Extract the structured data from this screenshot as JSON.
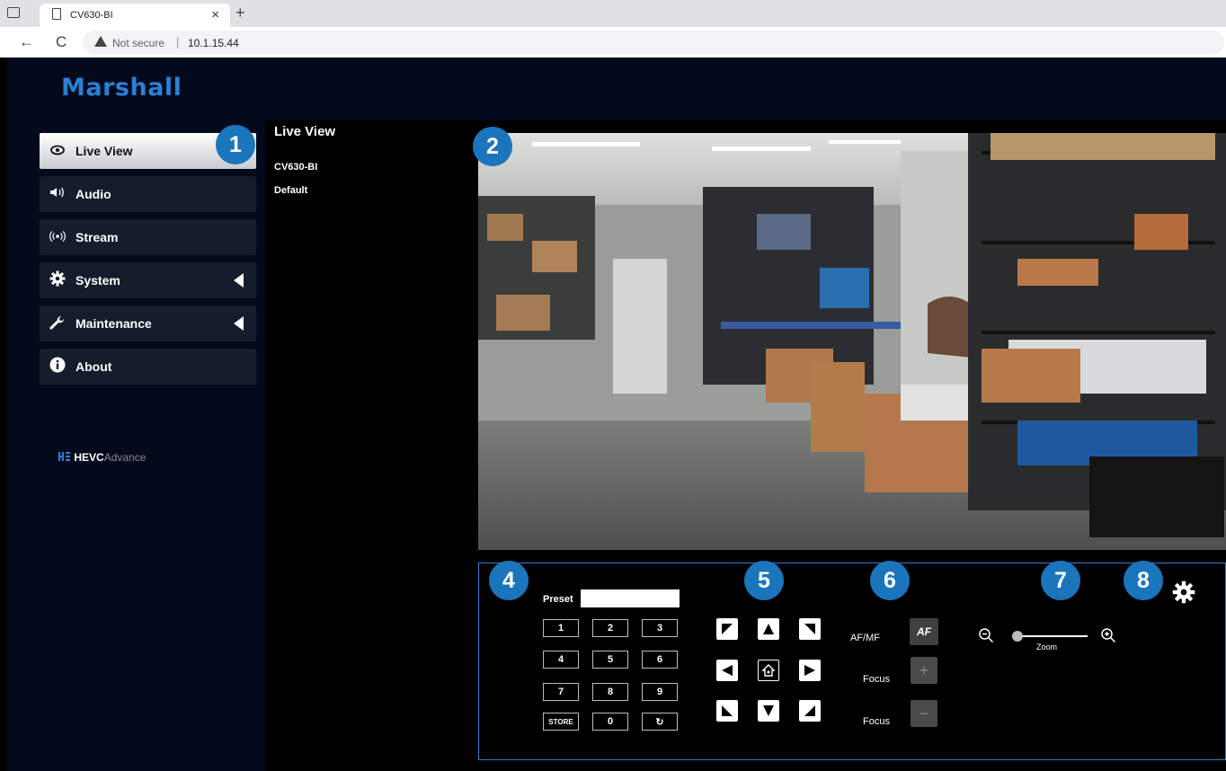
{
  "browser": {
    "tab_title": "CV630-BI",
    "close_glyph": "×",
    "new_tab_glyph": "+",
    "back_glyph": "←",
    "reload_glyph": "C",
    "security_text": "Not secure",
    "url": "10.1.15.44"
  },
  "header": {
    "logo_text": "Marshall"
  },
  "sidebar": {
    "items": [
      {
        "label": "Live View",
        "icon": "eye-icon",
        "active": true
      },
      {
        "label": "Audio",
        "icon": "speaker-icon"
      },
      {
        "label": "Stream",
        "icon": "broadcast-icon"
      },
      {
        "label": "System",
        "icon": "gear-icon",
        "expandable": true
      },
      {
        "label": "Maintenance",
        "icon": "wrench-icon",
        "expandable": true
      },
      {
        "label": "About",
        "icon": "info-icon"
      }
    ],
    "hevc_logo_bold": "HEVC",
    "hevc_logo_thin": "Advance"
  },
  "main": {
    "title": "Live View",
    "camera_name": "CV630-BI",
    "profile": "Default"
  },
  "callouts": [
    "1",
    "2",
    "4",
    "5",
    "6",
    "7",
    "8"
  ],
  "preset": {
    "label": "Preset",
    "value": "",
    "keys": [
      "1",
      "2",
      "3",
      "4",
      "5",
      "6",
      "7",
      "8",
      "9",
      "STORE",
      "0",
      "↻"
    ]
  },
  "focus": {
    "afmf_label": "AF/MF",
    "af_button": "AF",
    "focus_label": "Focus",
    "plus": "+",
    "minus": "−"
  },
  "zoom": {
    "label": "Zoom",
    "level": 0
  },
  "colors": {
    "accent": "#1b75bc",
    "panel_border": "#2f7ed1",
    "logo": "#2b7fd6",
    "sidebar_bg": "#030a1c"
  }
}
